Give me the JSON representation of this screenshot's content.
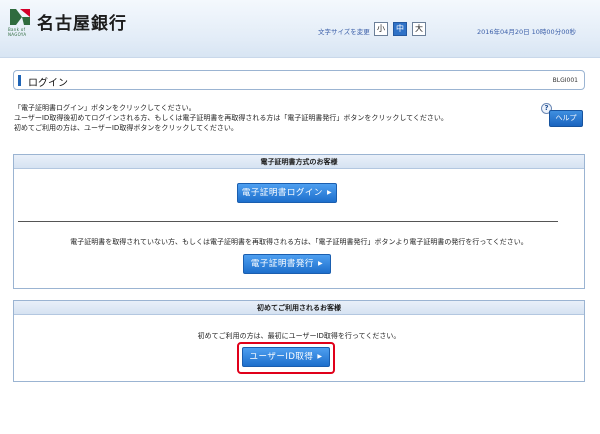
{
  "header": {
    "logo_sub": "Bank of\nNAGOYA",
    "bank_name": "名古屋銀行",
    "font_size_label": "文字サイズを変更",
    "font_small": "小",
    "font_medium": "中",
    "font_large": "大",
    "datetime": "2016年04月20日 10時00分00秒"
  },
  "page": {
    "title": "ログイン",
    "screen_id": "BLGI001"
  },
  "instructions": [
    "「電子証明書ログイン」ボタンをクリックしてください。",
    "ユーザーID取得後初めてログインされる方、もしくは電子証明書を再取得される方は「電子証明書発行」ボタンをクリックしてください。",
    "初めてご利用の方は、ユーザーID取得ボタンをクリックしてください。"
  ],
  "help": {
    "icon_text": "?",
    "label": "ヘルプ"
  },
  "cert_panel": {
    "title": "電子証明書方式のお客様",
    "login_button": "電子証明書ログイン",
    "note": "電子証明書を取得されていない方、もしくは電子証明書を再取得される方は、「電子証明書発行」ボタンより電子証明書の発行を行ってください。",
    "issue_button": "電子証明書発行"
  },
  "first_panel": {
    "title": "初めてご利用されるお客様",
    "note": "初めてご利用の方は、最初にユーザーID取得を行ってください。",
    "userid_button": "ユーザーID取得"
  },
  "colors": {
    "accent_blue": "#1d6fcc",
    "highlight_red": "#e0001a",
    "logo_green": "#2f6b3e",
    "logo_red": "#d4002a"
  }
}
